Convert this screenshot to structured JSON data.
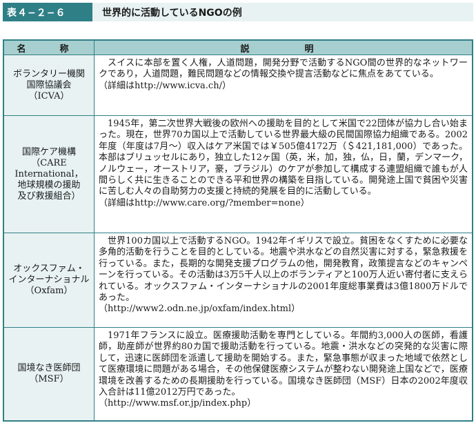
{
  "header": {
    "table_number": "表４−２−６",
    "title": "世界的に活動しているNGOの例"
  },
  "columns": {
    "name": "名　称",
    "description": "説　　明"
  },
  "rows": [
    {
      "name_lines": [
        "ボランタリー機関",
        "国際協議会",
        "（ICVA）"
      ],
      "body": "スイスに本部を置く人権，人道問題，開発分野で活動するNGO間の世界的なネットワークであり，人道問題，難民問題などの情報交換や提言活動などに焦点をあてている。",
      "ref": "（詳細はhttp://www.icva.ch/）"
    },
    {
      "name_lines": [
        "国際ケア機構",
        "（CARE",
        "International，",
        "地球規模の援助",
        "及び救援組合）"
      ],
      "body": "1945年，第二次世界大戦後の欧州への援助を目的として米国で22団体が協力し合い始まった。現在，世界70カ国以上で活動している世界最大級の民間国際協力組織である。2002年度（年度は7月〜）収入はケア米国では￥505億4172万（＄421,181,000）であった。本部はブリュッセルにあり，独立した12ヶ国（英，米，加，独，仏，日，蘭，デンマーク，ノルウェー，オーストリア，豪，ブラジル）のケアが参加して構成する連盟組織で誰もが人間らしく共に生きることのできる平和世界の構築を目指している。開発途上国で貧困や災害に苦しむ人々の自助努力の支援と持続的発展を目的に活動している。",
      "ref": "（詳細はhttp://www.care.org/?member=none）"
    },
    {
      "name_lines": [
        "オックスファム・",
        "インターナショナル",
        "（Oxfam）"
      ],
      "body": "世界100カ国以上で活動するNGO。1942年イギリスで設立。貧困をなくすために必要な多角的活動を行うことを目的としている。地震や洪水などの自然災害に対する，緊急救援を行っている。また，長期的な開発支援プログラムの他，開発教育，政策提言などのキャンペーンを行っている。その活動は3万5千人以上のボランティアと100万人近い寄付者に支えられている。オックスファム・インターナショナルの2001年度総事業費は3億1800万ドルであった。",
      "ref": "（http://www2.odn.ne.jp/oxfam/index.html）"
    },
    {
      "name_lines": [
        "国境なき医師団",
        "（MSF）"
      ],
      "body": "1971年フランスに設立。医療援助活動を専門としている。年間約3,000人の医師，看護師，助産師が世界約80カ国で援助活動を行っている。地震・洪水などの突発的な災害に際して，迅速に医師団を派遣して援助を開始する。また，緊急事態が収まった地域で依然として医療環境に問題がある場合，その他保健医療システムが整わない開発途上国などで，医療環境を改善するための長期援助を行っている。国境なき医師団（MSF）日本の2002年度収入合計は11億2012万円であった。",
      "ref": "（http://www.msf.or.jp/index.php）"
    }
  ]
}
